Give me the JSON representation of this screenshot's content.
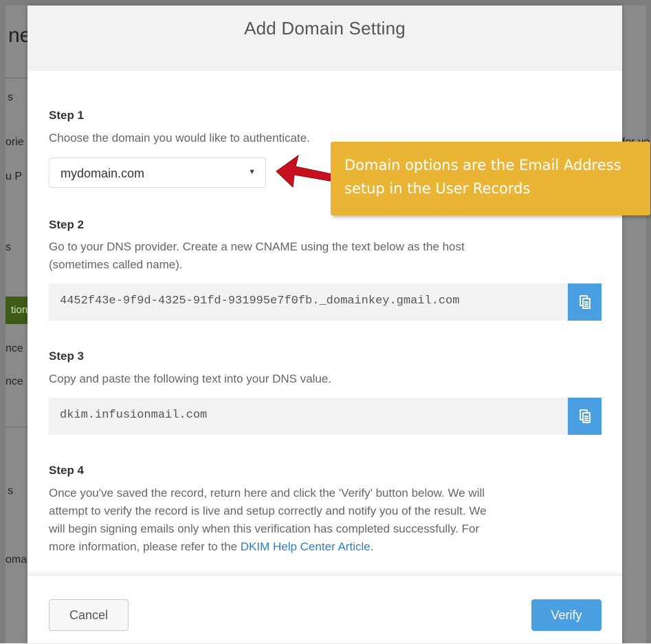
{
  "background": {
    "title_fragment": "ne",
    "fragments": [
      "s",
      "orie",
      "u P",
      "s",
      "tion",
      "nce",
      "nce",
      "s",
      "oma",
      "for yo"
    ]
  },
  "modal": {
    "title": "Add Domain Setting",
    "step1": {
      "title": "Step 1",
      "text": "Choose the domain you would like to authenticate.",
      "select_value": "mydomain.com"
    },
    "step2": {
      "title": "Step 2",
      "text_line1": "Go to your DNS provider. Create a new CNAME using the text below as the host",
      "text_line2": "(sometimes called name).",
      "code": "4452f43e-9f9d-4325-91fd-931995e7f0fb._domainkey.gmail.com"
    },
    "step3": {
      "title": "Step 3",
      "text": "Copy and paste the following text into your DNS value.",
      "code": "dkim.infusionmail.com"
    },
    "step4": {
      "title": "Step 4",
      "line1": "Once you've saved the record, return here and click the 'Verify' button below. We will",
      "line2": "attempt to verify the record is live and setup correctly and notify you of the result. We",
      "line3": "will begin signing emails only when this verification has completed successfully. For",
      "line4_prefix": "more information, please refer to the ",
      "link_text": "DKIM Help Center Article",
      "line4_suffix": "."
    },
    "footer": {
      "cancel_label": "Cancel",
      "verify_label": "Verify"
    }
  },
  "callout": {
    "line1": "Domain options are the Email Address",
    "line2": "setup in the User Records"
  },
  "colors": {
    "accent": "#4a9fe0",
    "callout": "#eab534",
    "arrow": "#c8101e",
    "link": "#2f7dc1"
  }
}
